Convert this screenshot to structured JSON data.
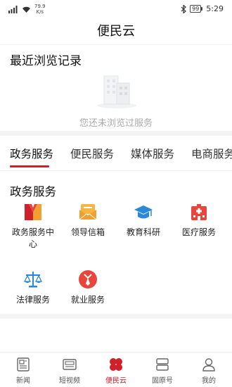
{
  "status": {
    "speed_top": "79.9",
    "speed_unit": "K/s",
    "battery": "99",
    "time": "5:29"
  },
  "header": {
    "title": "便民云"
  },
  "recent": {
    "title": "最近浏览记录",
    "empty_text": "您还未浏览过服务"
  },
  "tabs": [
    {
      "label": "政务服务",
      "active": true
    },
    {
      "label": "便民服务"
    },
    {
      "label": "媒体服务"
    },
    {
      "label": "电商服务"
    }
  ],
  "section": {
    "title": "政务服务"
  },
  "services": [
    {
      "label": "政务服务中心",
      "icon": "gov-service-center-icon"
    },
    {
      "label": "领导信箱",
      "icon": "mailbox-icon"
    },
    {
      "label": "教育科研",
      "icon": "graduation-cap-icon"
    },
    {
      "label": "医疗服务",
      "icon": "hospital-icon"
    },
    {
      "label": "法律服务",
      "icon": "scales-icon"
    },
    {
      "label": "就业服务",
      "icon": "employment-icon"
    }
  ],
  "nav": [
    {
      "label": "新闻",
      "icon": "news-icon"
    },
    {
      "label": "短视频",
      "icon": "video-icon"
    },
    {
      "label": "便民云",
      "icon": "cloud-service-icon",
      "active": true
    },
    {
      "label": "固原号",
      "icon": "account-icon"
    },
    {
      "label": "我的",
      "icon": "profile-icon"
    }
  ],
  "colors": {
    "accent": "#d0202a",
    "orange": "#f0a030",
    "blue": "#2a88d8",
    "red": "#e8453c"
  }
}
